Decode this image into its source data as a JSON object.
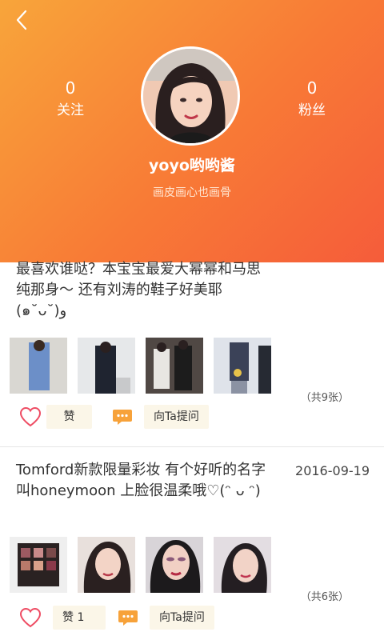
{
  "header": {
    "following": {
      "count": "0",
      "label": "关注"
    },
    "followers": {
      "count": "0",
      "label": "粉丝"
    },
    "username": "yoyo哟哟酱",
    "signature": "画皮画心也画骨"
  },
  "posts": [
    {
      "text": "最喜欢谁哒？本宝宝最爱大幂幂和马思纯那身～ 还有刘涛的鞋子好美耶(๑˘ᴗ˘)و",
      "date": "",
      "count_label": "（共9张）",
      "like_label": "赞",
      "ask_label": "向Ta提问"
    },
    {
      "text": "Tomford新款限量彩妆 有个好听的名字叫honeymoon 上脸很温柔哦♡(ᵔ ᴗ ᵔ)",
      "date": "2016-09-19",
      "count_label": "（共6张）",
      "like_label": "赞 1",
      "ask_label": "向Ta提问"
    }
  ],
  "icons": {
    "back": "chevron-left-icon",
    "like": "heart-icon",
    "ask": "chat-bubble-icon"
  },
  "colors": {
    "header_start": "#f8a53a",
    "header_end": "#f55c3a",
    "accent": "#f7a23a",
    "heart": "#ee4c63"
  }
}
